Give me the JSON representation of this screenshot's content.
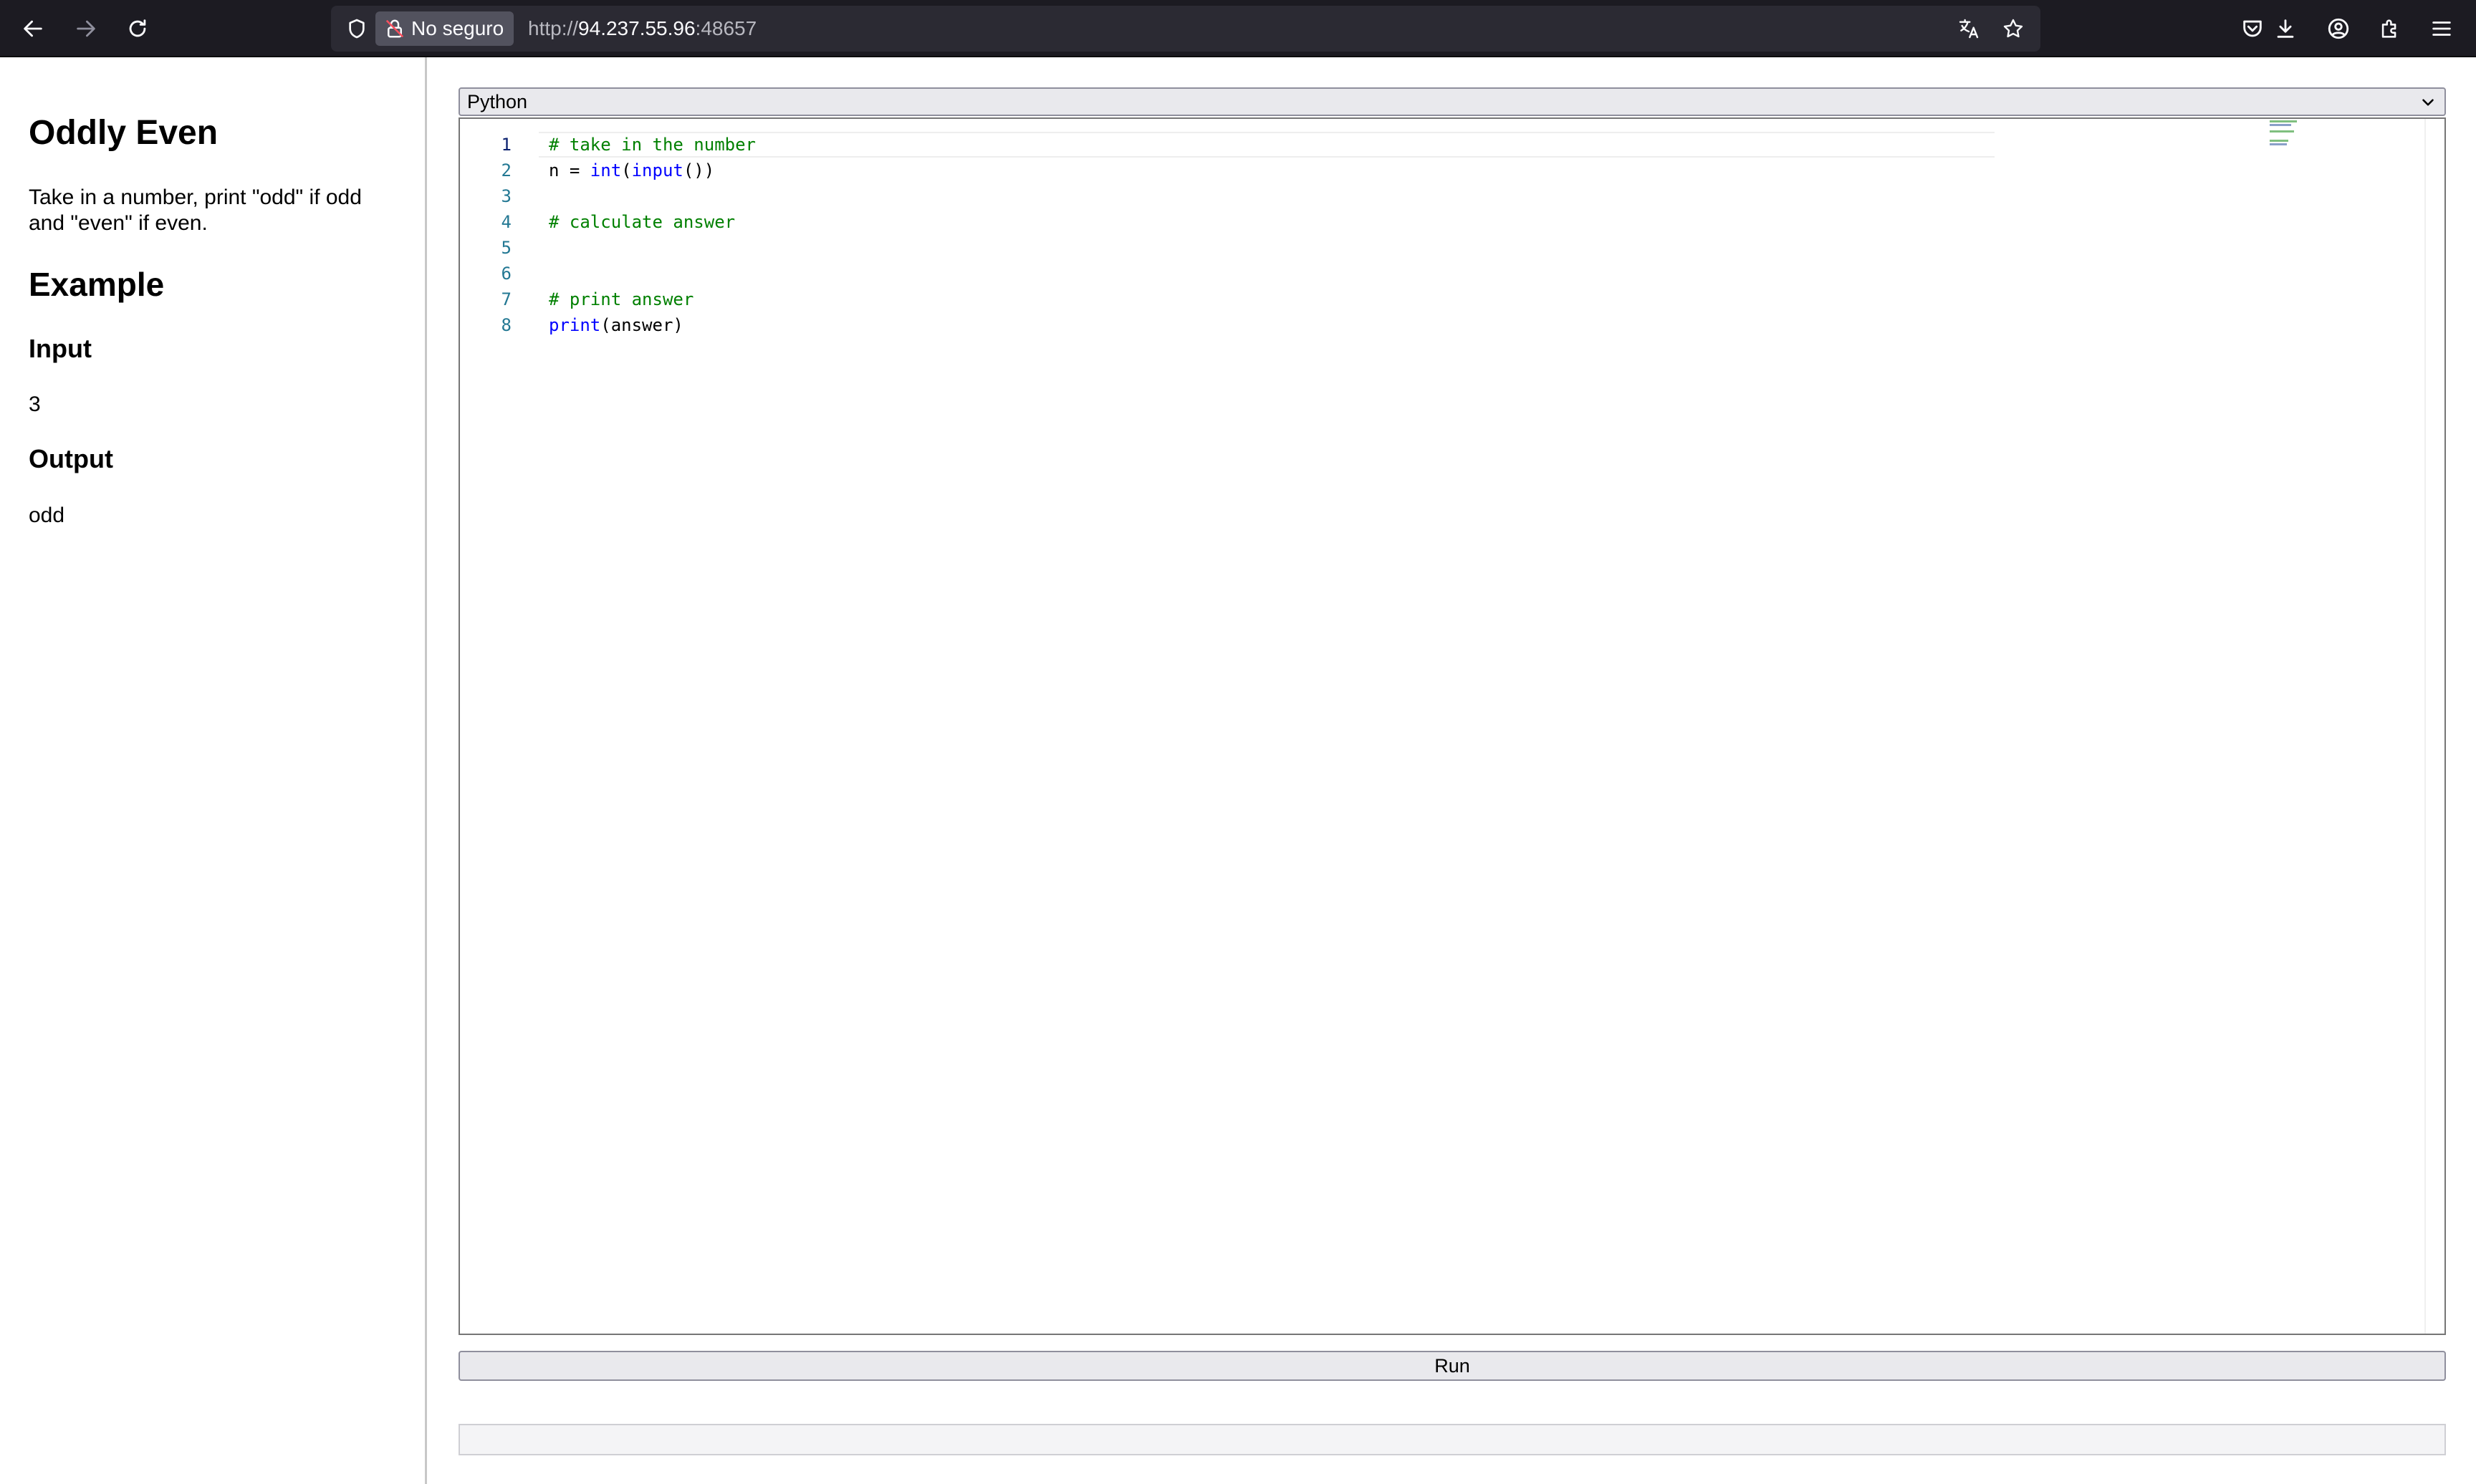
{
  "browser": {
    "security_label": "No seguro",
    "url_prefix": "http://",
    "url_host": "94.237.55.96",
    "url_port": ":48657",
    "icons": {
      "back": "arrow-left-icon",
      "forward": "arrow-right-icon",
      "reload": "reload-icon",
      "tracking": "shield-icon",
      "insecure": "lock-slash-icon",
      "translate": "translate-icon",
      "bookmark": "star-icon",
      "pocket": "pocket-icon",
      "downloads": "download-icon",
      "account": "account-icon",
      "extensions": "puzzle-icon",
      "menu": "hamburger-menu-icon"
    }
  },
  "problem": {
    "title": "Oddly Even",
    "description": "Take in a number, print \"odd\" if odd and \"even\" if even.",
    "example_heading": "Example",
    "input_heading": "Input",
    "input_value": "3",
    "output_heading": "Output",
    "output_value": "odd"
  },
  "editor": {
    "language": "Python",
    "lines": [
      {
        "num": "1",
        "text": "# take in the number"
      },
      {
        "num": "2",
        "text": "n = int(input())"
      },
      {
        "num": "3",
        "text": ""
      },
      {
        "num": "4",
        "text": "# calculate answer"
      },
      {
        "num": "5",
        "text": ""
      },
      {
        "num": "6",
        "text": ""
      },
      {
        "num": "7",
        "text": "# print answer"
      },
      {
        "num": "8",
        "text": "print(answer)"
      }
    ],
    "active_line": 1
  },
  "run_label": "Run",
  "output": "",
  "colors": {
    "comment": "#008000",
    "builtin": "#0000ff",
    "line_number": "#237893",
    "toolbar_bg": "#1c1b22"
  }
}
